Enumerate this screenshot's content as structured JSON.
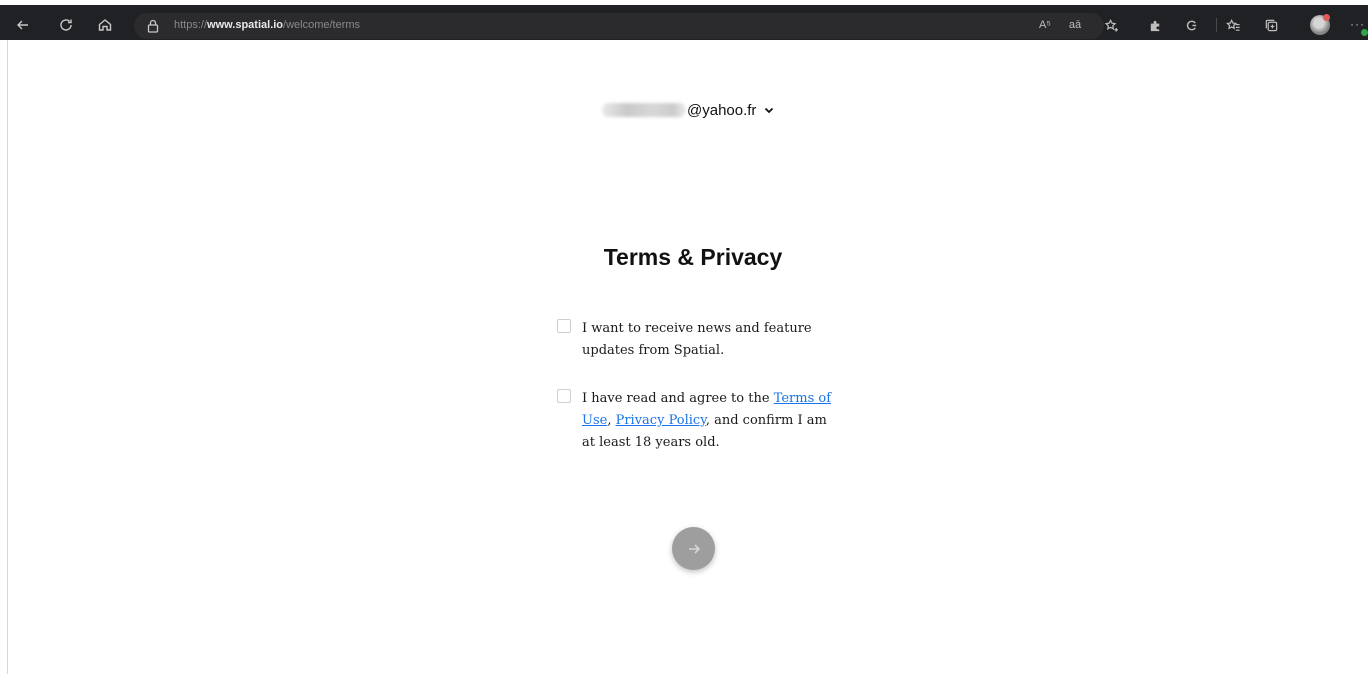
{
  "browser": {
    "url_prefix": "https://",
    "url_domain": "www.spatial.io",
    "url_path": "/welcome/terms",
    "read_aloud_label": "A⁵",
    "translate_label": "aā"
  },
  "account": {
    "email_suffix": "@yahoo.fr"
  },
  "page": {
    "title": "Terms & Privacy"
  },
  "options": {
    "newsletter_text": "I want to receive news and feature updates from Spatial.",
    "agree_prefix": "I have read and agree to the ",
    "terms_link": "Terms of Use",
    "agree_sep": ", ",
    "privacy_link": "Privacy Policy",
    "agree_suffix": ", and confirm I am at least 18 years old."
  },
  "colors": {
    "link": "#1a73e8",
    "next_button": "#9e9e9e",
    "toolbar": "#202124"
  }
}
